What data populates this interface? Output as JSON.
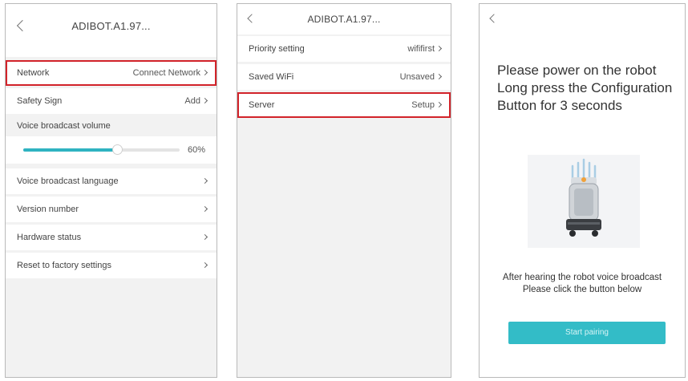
{
  "screen1": {
    "title": "ADIBOT.A1.97...",
    "network": {
      "label": "Network",
      "value": "Connect Network"
    },
    "safety": {
      "label": "Safety Sign",
      "value": "Add"
    },
    "volume_section": "Voice broadcast volume",
    "volume": {
      "percent_label": "60%",
      "fraction": 0.6
    },
    "items": [
      {
        "label": "Voice broadcast language"
      },
      {
        "label": "Version number"
      },
      {
        "label": "Hardware status"
      },
      {
        "label": "Reset to factory settings"
      }
    ],
    "highlight_color": "#d2232a",
    "accent_color": "#2fb3c1"
  },
  "screen2": {
    "title": "ADIBOT.A1.97...",
    "priority": {
      "label": "Priority setting",
      "value": "wififirst"
    },
    "saved_wifi": {
      "label": "Saved WiFi",
      "value": "Unsaved"
    },
    "server": {
      "label": "Server",
      "value": "Setup"
    }
  },
  "screen3": {
    "instruction": "Please power on the robot Long press the Configuration Button for 3 seconds",
    "after_line1": "After hearing the robot voice broadcast",
    "after_line2": "Please click the button below",
    "button_label": "Start pairing",
    "button_color": "#33bcc7"
  }
}
